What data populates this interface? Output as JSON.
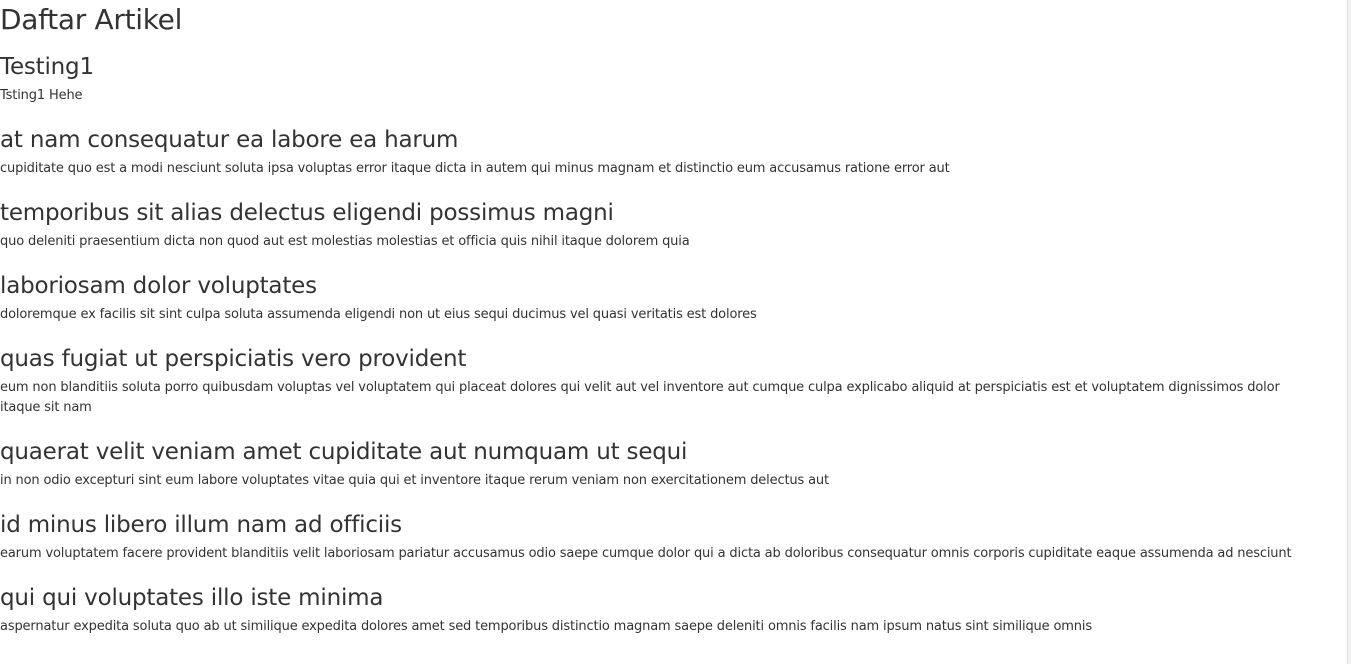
{
  "page": {
    "title": "Daftar Artikel"
  },
  "articles": [
    {
      "title": "Testing1",
      "body": "Tsting1 Hehe"
    },
    {
      "title": "at nam consequatur ea labore ea harum",
      "body": "cupiditate quo est a modi nesciunt soluta ipsa voluptas error itaque dicta in autem qui minus magnam et distinctio eum accusamus ratione error aut"
    },
    {
      "title": "temporibus sit alias delectus eligendi possimus magni",
      "body": "quo deleniti praesentium dicta non quod aut est molestias molestias et officia quis nihil itaque dolorem quia"
    },
    {
      "title": "laboriosam dolor voluptates",
      "body": "doloremque ex facilis sit sint culpa soluta assumenda eligendi non ut eius sequi ducimus vel quasi veritatis est dolores"
    },
    {
      "title": "quas fugiat ut perspiciatis vero provident",
      "body": "eum non blanditiis soluta porro quibusdam voluptas vel voluptatem qui placeat dolores qui velit aut vel inventore aut cumque culpa explicabo aliquid at perspiciatis est et voluptatem dignissimos dolor itaque sit nam"
    },
    {
      "title": "quaerat velit veniam amet cupiditate aut numquam ut sequi",
      "body": "in non odio excepturi sint eum labore voluptates vitae quia qui et inventore itaque rerum veniam non exercitationem delectus aut"
    },
    {
      "title": "id minus libero illum nam ad officiis",
      "body": "earum voluptatem facere provident blanditiis velit laboriosam pariatur accusamus odio saepe cumque dolor qui a dicta ab doloribus consequatur omnis corporis cupiditate eaque assumenda ad nesciunt"
    },
    {
      "title": "qui qui voluptates illo iste minima",
      "body": "aspernatur expedita soluta quo ab ut similique expedita dolores amet sed temporibus distinctio magnam saepe deleniti omnis facilis nam ipsum natus sint similique omnis"
    }
  ]
}
